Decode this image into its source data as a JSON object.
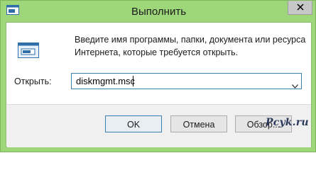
{
  "window": {
    "title": "Выполнить",
    "close_label": "close"
  },
  "description": {
    "line1": "Введите имя программы, папки, документа или ресурса",
    "line2": "Интернета, которые требуется открыть."
  },
  "open_field": {
    "label": "Открыть:",
    "value": "diskmgmt.msc"
  },
  "buttons": {
    "ok": "OK",
    "cancel": "Отмена",
    "browse": "Обзор..."
  },
  "watermark": "Pcyk.ru",
  "colors": {
    "frame": "#9ed67a",
    "accent_border": "#3c7fb1",
    "footer": "#f0f0f0"
  },
  "icons": {
    "app": "run-window-icon",
    "dialog": "run-program-icon",
    "close": "close-icon",
    "dropdown": "chevron-down-icon"
  }
}
